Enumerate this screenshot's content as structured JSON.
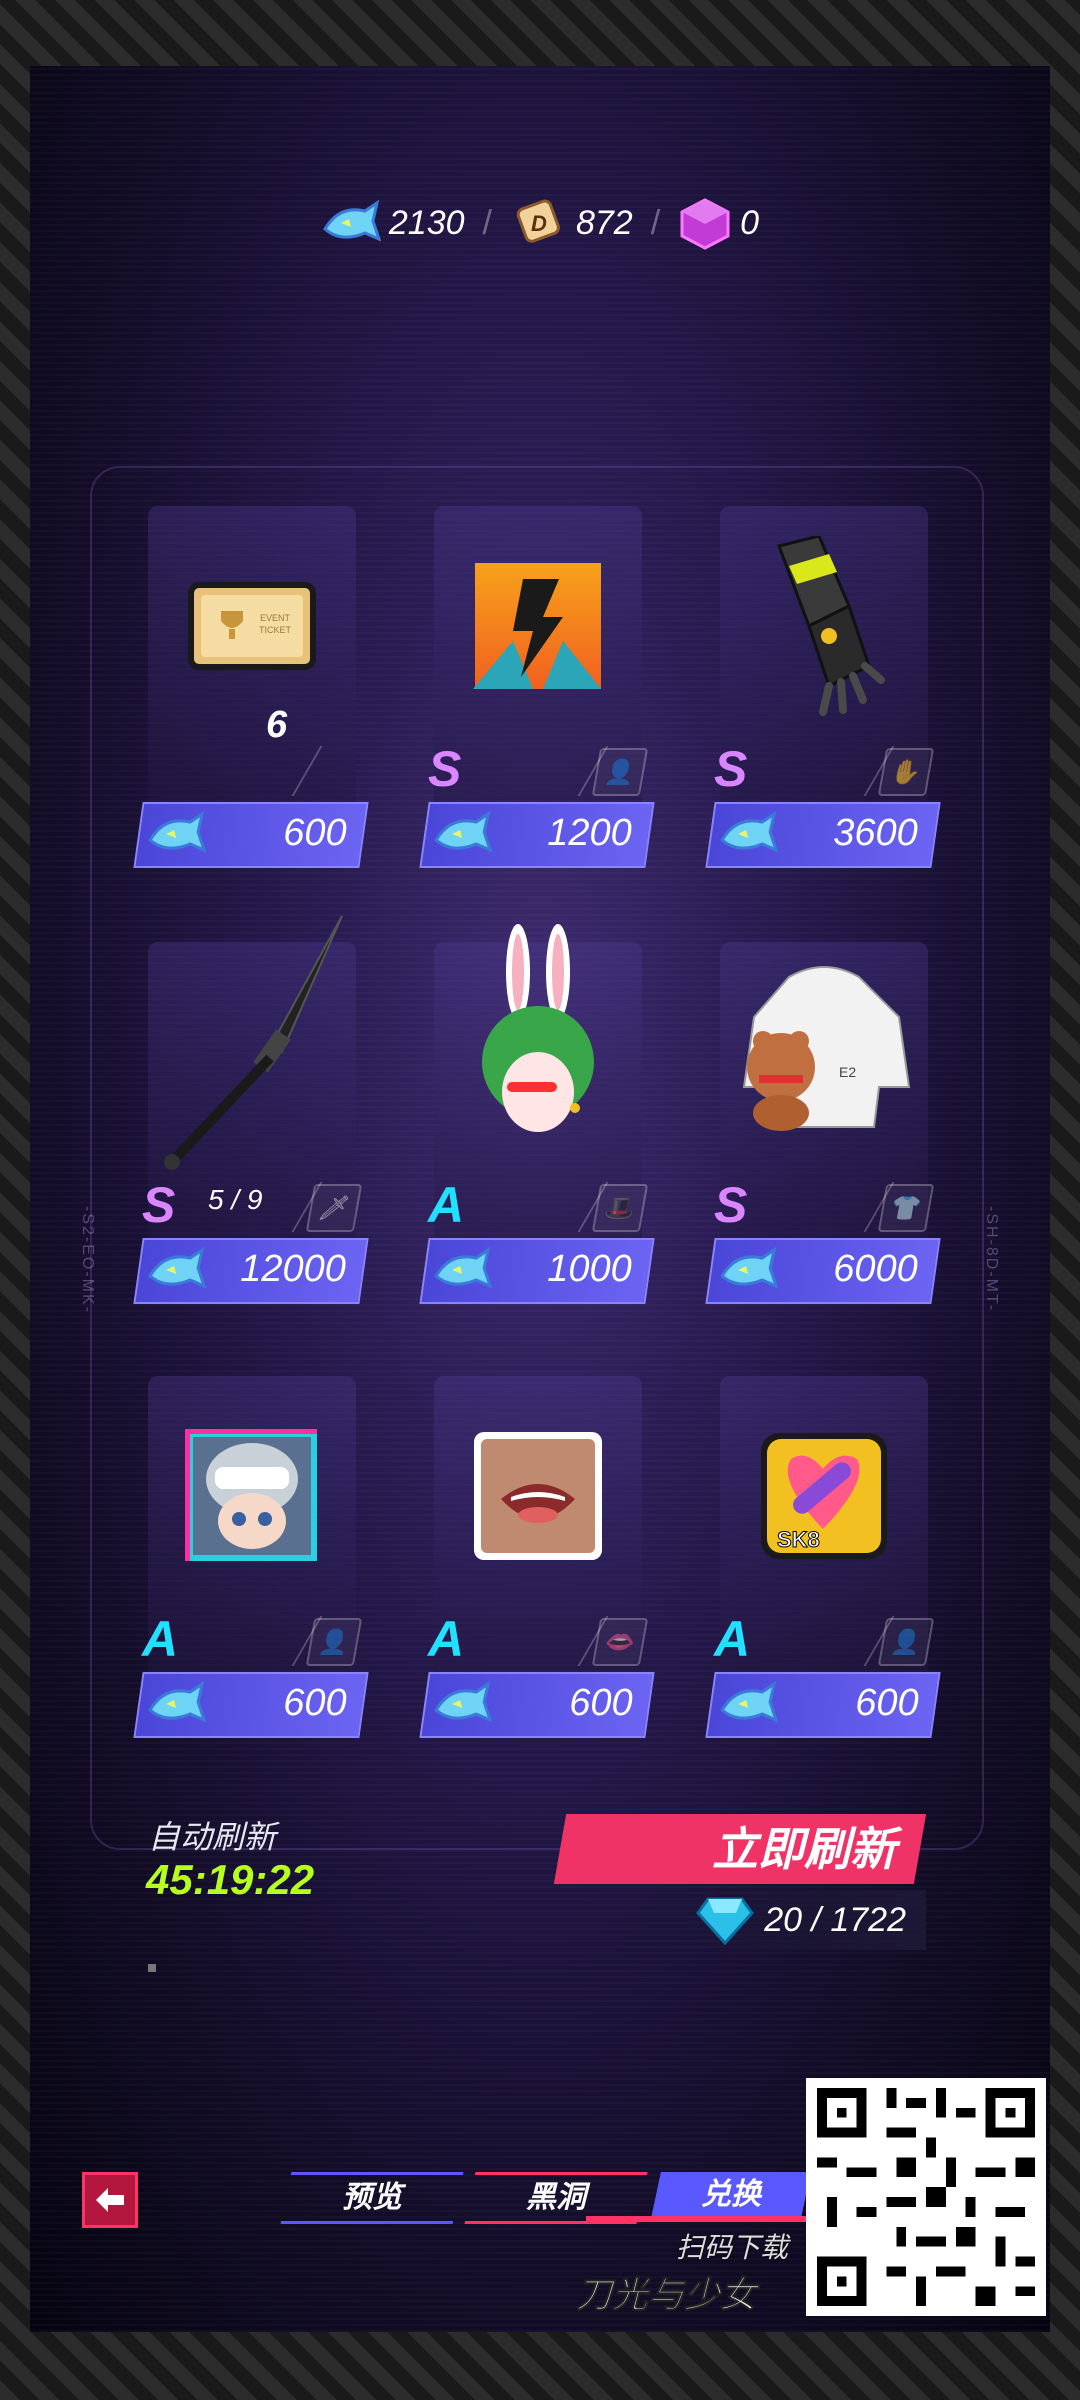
{
  "currencies": [
    {
      "name": "fish-token",
      "value": "2130"
    },
    {
      "name": "d-coin",
      "value": "872"
    },
    {
      "name": "cube",
      "value": "0"
    }
  ],
  "items": [
    {
      "id": "ticket",
      "icon": "ticket-icon",
      "rank": "",
      "count": "6",
      "slot_icon": "",
      "price": "600"
    },
    {
      "id": "lightning-avatar",
      "icon": "lightning-avatar-icon",
      "rank": "S",
      "count": "",
      "slot_icon": "avatar-slot-icon",
      "price": "1200"
    },
    {
      "id": "gauntlet",
      "icon": "gauntlet-icon",
      "rank": "S",
      "count": "",
      "slot_icon": "glove-slot-icon",
      "price": "3600"
    },
    {
      "id": "sword",
      "icon": "sword-icon",
      "rank": "S",
      "count": "5 / 9",
      "slot_icon": "weapon-slot-icon",
      "price": "12000"
    },
    {
      "id": "bunny-head",
      "icon": "bunny-head-icon",
      "rank": "A",
      "count": "",
      "slot_icon": "hat-slot-icon",
      "price": "1000"
    },
    {
      "id": "hoodie",
      "icon": "hoodie-icon",
      "rank": "S",
      "count": "",
      "slot_icon": "shirt-slot-icon",
      "price": "6000"
    },
    {
      "id": "helmet-portrait",
      "icon": "helmet-portrait-icon",
      "rank": "A",
      "count": "",
      "slot_icon": "avatar-slot-icon",
      "price": "600"
    },
    {
      "id": "mouth",
      "icon": "mouth-icon",
      "rank": "A",
      "count": "",
      "slot_icon": "lips-slot-icon",
      "price": "600"
    },
    {
      "id": "skate-badge",
      "icon": "skateboard-badge-icon",
      "rank": "A",
      "count": "",
      "slot_icon": "avatar-slot-icon",
      "price": "600"
    }
  ],
  "refresh": {
    "auto_label": "自动刷新",
    "timer": "45:19:22",
    "button_label": "立即刷新",
    "cost": "20 / 1722"
  },
  "nav": {
    "tabs": [
      "预览",
      "黑洞",
      "兑换"
    ],
    "active": "兑换"
  },
  "qr": {
    "caption1": "扫码下载",
    "caption2": "刀光与少女"
  },
  "colors": {
    "rank_s": "#d986ff",
    "rank_a": "#22e0ff",
    "price_button": "#5a58ff",
    "refresh_button": "#ef3366",
    "timer": "#b6ff1e"
  }
}
